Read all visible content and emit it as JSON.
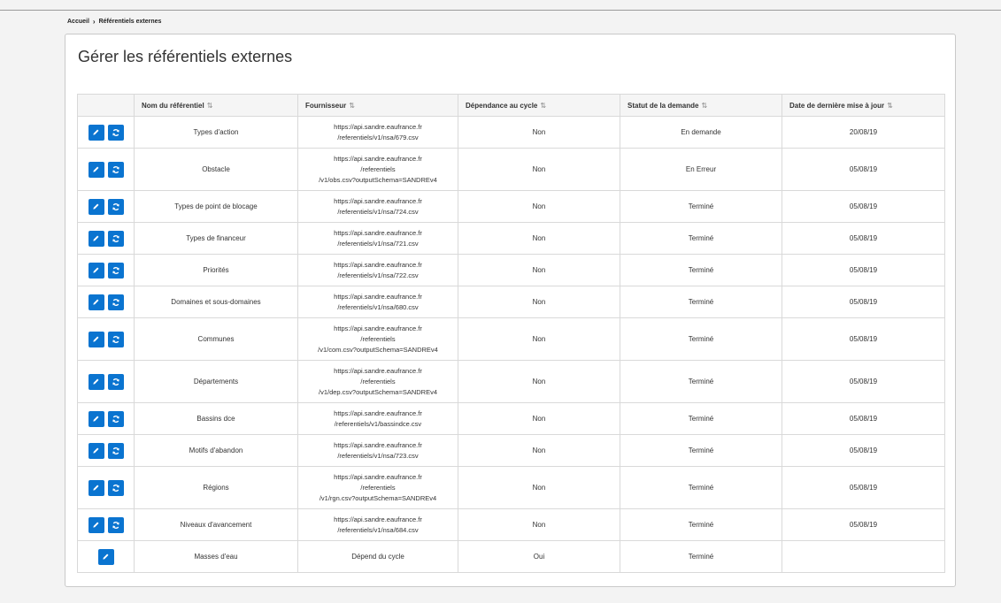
{
  "breadcrumb": {
    "home": "Accueil",
    "current": "Référentiels externes"
  },
  "page": {
    "title": "Gérer les référentiels externes"
  },
  "table": {
    "headers": [
      "Nom du référentiel",
      "Fournisseur",
      "Dépendance au cycle",
      "Statut de la demande",
      "Date de dernière mise à jour"
    ],
    "rows": [
      {
        "name": "Types d'action",
        "provider": [
          "https://api.sandre.eaufrance.fr",
          "/referentiels/v1/nsa/679.csv"
        ],
        "dependency": "Non",
        "status": "En demande",
        "date": "20/08/19",
        "refresh": true
      },
      {
        "name": "Obstacle",
        "provider": [
          "https://api.sandre.eaufrance.fr",
          "/referentiels",
          "/v1/obs.csv?outputSchema=SANDREv4"
        ],
        "dependency": "Non",
        "status": "En Erreur",
        "date": "05/08/19",
        "refresh": true
      },
      {
        "name": "Types de point de blocage",
        "provider": [
          "https://api.sandre.eaufrance.fr",
          "/referentiels/v1/nsa/724.csv"
        ],
        "dependency": "Non",
        "status": "Terminé",
        "date": "05/08/19",
        "refresh": true
      },
      {
        "name": "Types de financeur",
        "provider": [
          "https://api.sandre.eaufrance.fr",
          "/referentiels/v1/nsa/721.csv"
        ],
        "dependency": "Non",
        "status": "Terminé",
        "date": "05/08/19",
        "refresh": true
      },
      {
        "name": "Priorités",
        "provider": [
          "https://api.sandre.eaufrance.fr",
          "/referentiels/v1/nsa/722.csv"
        ],
        "dependency": "Non",
        "status": "Terminé",
        "date": "05/08/19",
        "refresh": true
      },
      {
        "name": "Domaines et sous-domaines",
        "provider": [
          "https://api.sandre.eaufrance.fr",
          "/referentiels/v1/nsa/680.csv"
        ],
        "dependency": "Non",
        "status": "Terminé",
        "date": "05/08/19",
        "refresh": true
      },
      {
        "name": "Communes",
        "provider": [
          "https://api.sandre.eaufrance.fr",
          "/referentiels",
          "/v1/com.csv?outputSchema=SANDREv4"
        ],
        "dependency": "Non",
        "status": "Terminé",
        "date": "05/08/19",
        "refresh": true
      },
      {
        "name": "Départements",
        "provider": [
          "https://api.sandre.eaufrance.fr",
          "/referentiels",
          "/v1/dep.csv?outputSchema=SANDREv4"
        ],
        "dependency": "Non",
        "status": "Terminé",
        "date": "05/08/19",
        "refresh": true
      },
      {
        "name": "Bassins dce",
        "provider": [
          "https://api.sandre.eaufrance.fr",
          "/referentiels/v1/bassindce.csv"
        ],
        "dependency": "Non",
        "status": "Terminé",
        "date": "05/08/19",
        "refresh": true
      },
      {
        "name": "Motifs d'abandon",
        "provider": [
          "https://api.sandre.eaufrance.fr",
          "/referentiels/v1/nsa/723.csv"
        ],
        "dependency": "Non",
        "status": "Terminé",
        "date": "05/08/19",
        "refresh": true
      },
      {
        "name": "Régions",
        "provider": [
          "https://api.sandre.eaufrance.fr",
          "/referentiels",
          "/v1/rgn.csv?outputSchema=SANDREv4"
        ],
        "dependency": "Non",
        "status": "Terminé",
        "date": "05/08/19",
        "refresh": true
      },
      {
        "name": "Niveaux d'avancement",
        "provider": [
          "https://api.sandre.eaufrance.fr",
          "/referentiels/v1/nsa/684.csv"
        ],
        "dependency": "Non",
        "status": "Terminé",
        "date": "05/08/19",
        "refresh": true
      },
      {
        "name": "Masses d'eau",
        "provider": [
          "Dépend du cycle"
        ],
        "dependency": "Oui",
        "status": "Terminé",
        "date": "",
        "refresh": false
      }
    ]
  },
  "colors": {
    "accent": "#0a74d0"
  },
  "icons": {
    "edit": "pencil-icon",
    "refresh": "refresh-icon",
    "breadcrumb_separator": "chevron-right-icon",
    "sort": "sort-icon"
  }
}
